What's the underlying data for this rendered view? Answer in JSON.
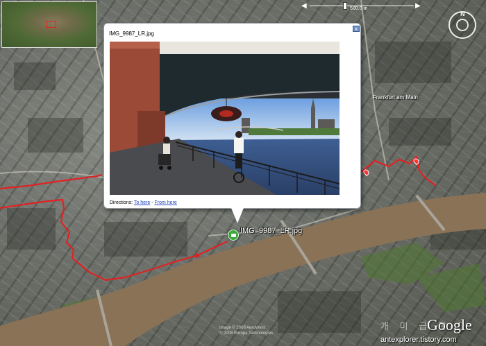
{
  "balloon": {
    "title": "IMG_9987_LR.jpg",
    "directions_label": "Directions:",
    "to_here": "To here",
    "separator": "-",
    "from_here": "From here",
    "close_glyph": "x"
  },
  "placemark": {
    "label": "IMG_9987_LR.jpg",
    "icon": "camera-icon"
  },
  "map": {
    "label": "Frankfurt am Main"
  },
  "topbar": {
    "label": "500.0 m"
  },
  "compass": {
    "north": "N"
  },
  "copyright": {
    "line1": "Image © 2008 AeroWest",
    "line2": "© 2008 Europa Technologies"
  },
  "brand": "Google",
  "watermark": {
    "korean": "개 미 급 힐",
    "url": "antexplorer.tistory.com"
  },
  "colors": {
    "gps_track": "#e02222",
    "river": "#8a7257",
    "placemark": "#3ba93b",
    "balloon_link": "#1a3fbf"
  }
}
